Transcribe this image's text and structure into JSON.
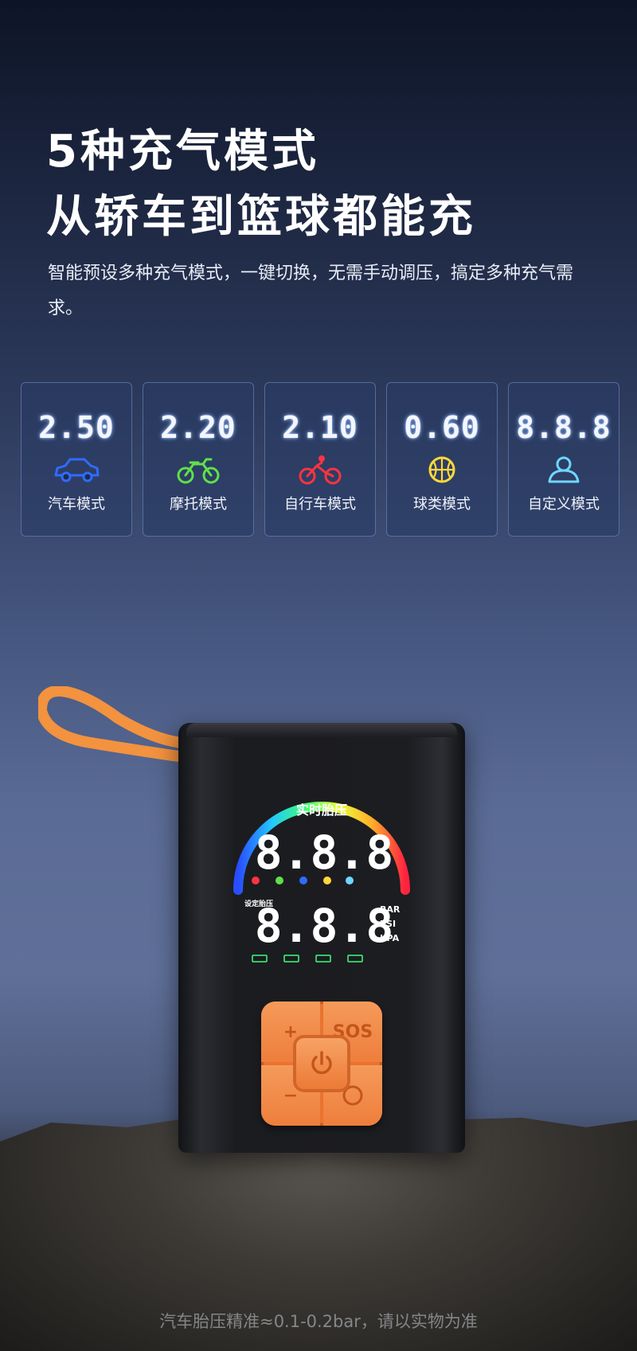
{
  "hero": {
    "title_line1": "5种充气模式",
    "title_line2": "从轿车到篮球都能充",
    "subtitle": "智能预设多种充气模式，一键切换，无需手动调压，搞定多种充气需求。"
  },
  "modes": [
    {
      "value": "2.50",
      "label": "汽车模式",
      "icon": "car-icon",
      "color": "#2f6bff"
    },
    {
      "value": "2.20",
      "label": "摩托模式",
      "icon": "motorcycle-icon",
      "color": "#5fe04a"
    },
    {
      "value": "2.10",
      "label": "自行车模式",
      "icon": "bicycle-icon",
      "color": "#ff3340"
    },
    {
      "value": "0.60",
      "label": "球类模式",
      "icon": "ball-icon",
      "color": "#ffd83a"
    },
    {
      "value": "8.8.8",
      "label": "自定义模式",
      "icon": "custom-icon",
      "color": "#6fd6ff"
    }
  ],
  "device": {
    "gauge_label": "实时胎压",
    "readout_top": "8.8.8",
    "readout_bottom": "8.8.8",
    "set_label": "设定胎压",
    "units": [
      "BAR",
      "PSI",
      "KPA"
    ],
    "keys": {
      "plus": "+",
      "sos": "SOS",
      "minus": "−"
    }
  },
  "footer": {
    "disclaimer": "汽车胎压精准≈0.1-0.2bar，请以实物为准"
  }
}
